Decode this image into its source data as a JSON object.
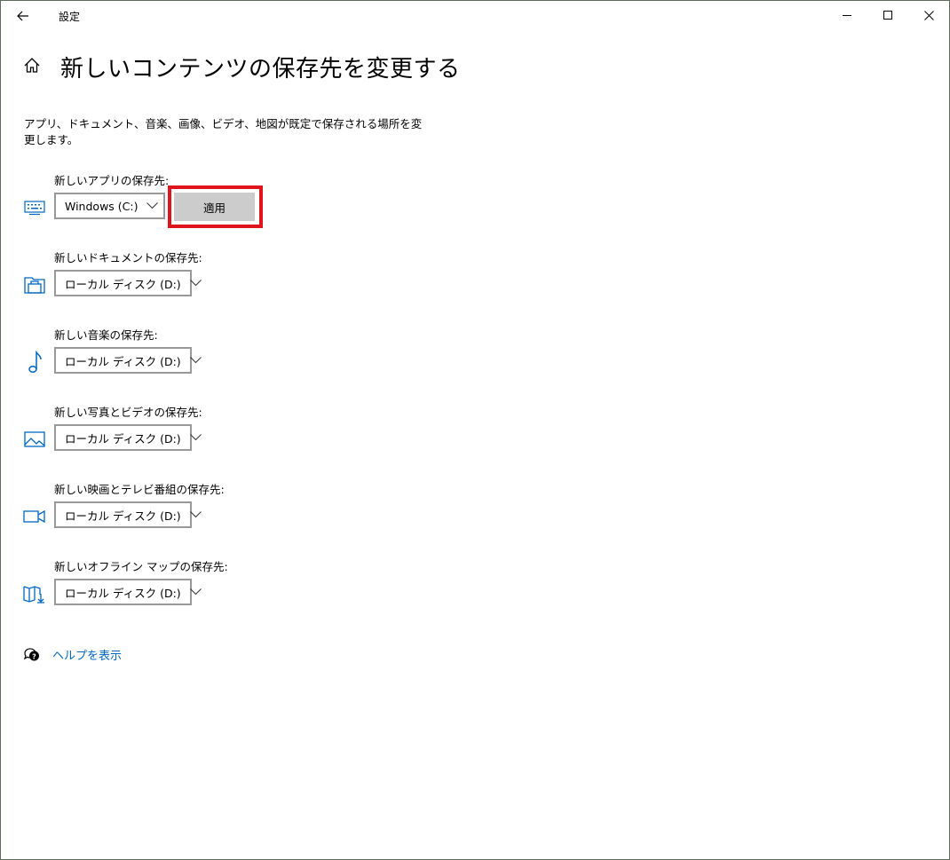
{
  "window": {
    "title": "設定",
    "controls": {
      "minimize": "minimize",
      "maximize": "maximize",
      "close": "close"
    }
  },
  "page": {
    "title": "新しいコンテンツの保存先を変更する",
    "description": "アプリ、ドキュメント、音楽、画像、ビデオ、地図が既定で保存される場所を変更します。"
  },
  "settings": [
    {
      "label": "新しいアプリの保存先:",
      "value": "Windows (C:)",
      "icon": "keyboard-icon"
    },
    {
      "label": "新しいドキュメントの保存先:",
      "value": "ローカル ディスク (D:)",
      "icon": "folder-icon"
    },
    {
      "label": "新しい音楽の保存先:",
      "value": "ローカル ディスク (D:)",
      "icon": "music-note-icon"
    },
    {
      "label": "新しい写真とビデオの保存先:",
      "value": "ローカル ディスク (D:)",
      "icon": "picture-icon"
    },
    {
      "label": "新しい映画とテレビ番組の保存先:",
      "value": "ローカル ディスク (D:)",
      "icon": "video-camera-icon"
    },
    {
      "label": "新しいオフライン マップの保存先:",
      "value": "ローカル ディスク (D:)",
      "icon": "map-download-icon"
    }
  ],
  "apply_button": {
    "label": "適用"
  },
  "help": {
    "label": "ヘルプを表示"
  },
  "colors": {
    "accent": "#0067c0",
    "highlight": "#e0141c",
    "button_bg": "#cccccc"
  }
}
